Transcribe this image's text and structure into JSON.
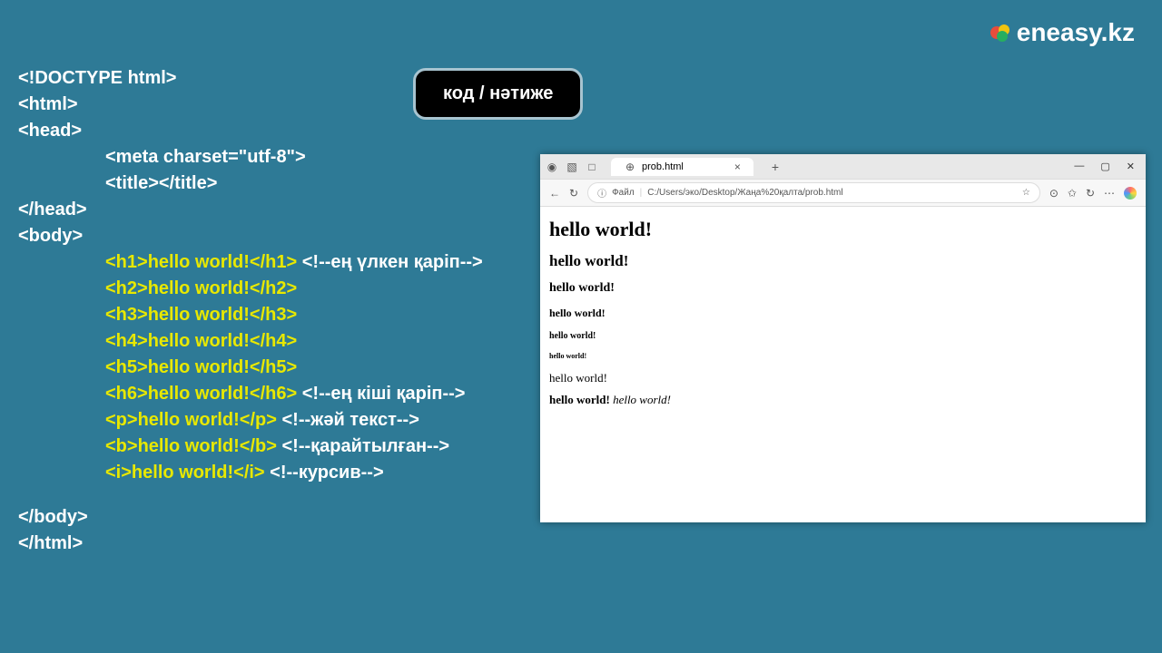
{
  "logo": {
    "text": "eneasy.kz"
  },
  "toggle": {
    "label": "код / нәтиже"
  },
  "code": {
    "l1": "<!DOCTYPE html>",
    "l2": "<html>",
    "l3": "<head>",
    "l4": "<meta charset=\"utf-8\">",
    "l5": "<title></title>",
    "l6": "</head>",
    "l7": "<body>",
    "l8a": "<h1>hello world!</h1>",
    "l8b": " <!--ең үлкен қаріп-->",
    "l9": "<h2>hello world!</h2>",
    "l10": "<h3>hello world!</h3>",
    "l11": "<h4>hello world!</h4>",
    "l12": "<h5>hello world!</h5>",
    "l13a": "<h6>hello world!</h6>",
    "l13b": " <!--ең кіші қаріп-->",
    "l14a": "<p>hello world!</p>",
    "l14b": " <!--жәй текст-->",
    "l15a": "<b>hello world!</b>",
    "l15b": " <!--қарайтылған-->",
    "l16a": "<i>hello world!</i>",
    "l16b": " <!--курсив-->",
    "l17": "</body>",
    "l18": "</html>"
  },
  "browser": {
    "tab_title": "prob.html",
    "tab_close": "×",
    "tab_new": "+",
    "win_min": "—",
    "win_max": "▢",
    "win_close": "✕",
    "nav_back": "←",
    "nav_reload": "↻",
    "addr_info": "ⓘ",
    "addr_label": "Файл",
    "addr_pipe": "|",
    "addr_path": "C:/Users/эко/Desktop/Жаңа%20қалта/prob.html",
    "star": "☆",
    "ext": "⊙",
    "fav": "✩",
    "sync": "↻",
    "more": "⋯",
    "globe": "⊕",
    "square1": "▧",
    "square2": "□",
    "person": "◉",
    "content": {
      "h1": "hello world!",
      "h2": "hello world!",
      "h3": "hello world!",
      "h4": "hello world!",
      "h5": "hello world!",
      "h6": "hello world!",
      "p": "hello world!",
      "b": "hello world!",
      "i": "hello world!"
    }
  }
}
